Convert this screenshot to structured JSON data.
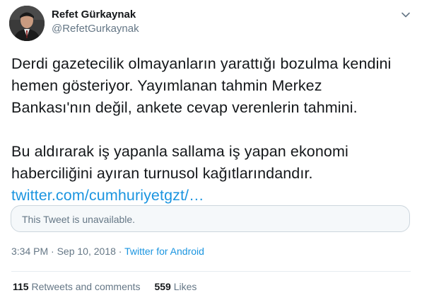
{
  "author": {
    "name": "Refet Gürkaynak",
    "handle": "@RefetGurkaynak"
  },
  "icons": {
    "avatar": "profile-photo",
    "menu": "chevron-down-icon"
  },
  "tweet": {
    "lines_para1": [
      "Derdi gazetecilik olmayanların yarattığı bozulma kendini",
      "hemen gösteriyor. Yayımlanan tahmin Merkez",
      "Bankası'nın değil, ankete cevap verenlerin tahmini."
    ],
    "lines_para2": [
      "Bu aldırarak iş yapanla sallama iş yapan ekonomi",
      "haberciliğini ayıran turnusol kağıtlarındandır."
    ],
    "link": "twitter.com/cumhuriyetgzt/…",
    "quoted_unavailable": "This Tweet is unavailable.",
    "time": "3:34 PM",
    "separator": "·",
    "date": "Sep 10, 2018",
    "source": "Twitter for Android"
  },
  "stats": {
    "retweets_count": "115",
    "retweets_label": "Retweets and comments",
    "likes_count": "559",
    "likes_label": "Likes"
  },
  "colors": {
    "link": "#1b95e0",
    "secondary_text": "#657786",
    "primary_text": "#14171a",
    "border": "#ccd6dd"
  }
}
